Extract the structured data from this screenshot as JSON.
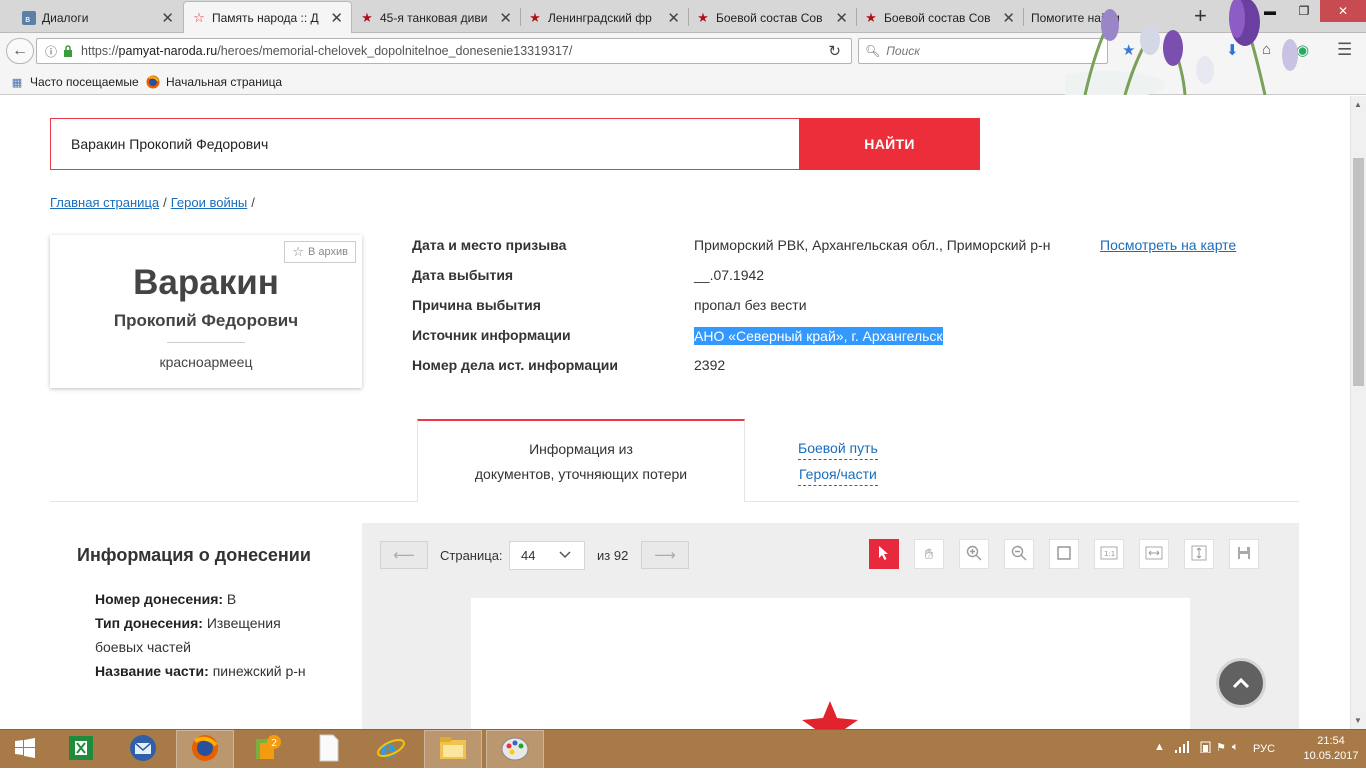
{
  "browser": {
    "tabs": [
      {
        "title": "Диалоги",
        "icon": "vk-icon"
      },
      {
        "title": "Память народа :: Д",
        "icon": "star-outline-icon",
        "active": true
      },
      {
        "title": "45-я танковая диви",
        "icon": "red-star-icon"
      },
      {
        "title": "Ленинградский фр",
        "icon": "red-star-icon"
      },
      {
        "title": "Боевой состав Сов",
        "icon": "red-star-icon"
      },
      {
        "title": "Боевой состав Сов",
        "icon": "red-star-icon"
      },
      {
        "title": "Помогите найти",
        "icon": ""
      }
    ],
    "url_prefix": "https://",
    "url_domain": "pamyat-naroda.ru",
    "url_path": "/heroes/memorial-chelovek_dopolnitelnoe_donesenie13319317/",
    "search_placeholder": "Поиск",
    "bookmarks": [
      "Часто посещаемые",
      "Начальная страница"
    ]
  },
  "search": {
    "value": "Варакин Прокопий Федорович",
    "button": "НАЙТИ"
  },
  "breadcrumb": {
    "home": "Главная страница",
    "heroes": "Герои войны",
    "sep": "/"
  },
  "person": {
    "archive_label": "В архив",
    "surname": "Варакин",
    "names": "Прокопий Федорович",
    "rank": "красноармеец"
  },
  "details": [
    {
      "label": "Дата и место призыва",
      "value": "Приморский РВК, Архангельская обл., Приморский р-н"
    },
    {
      "label": "Дата выбытия",
      "value": "__.07.1942"
    },
    {
      "label": "Причина выбытия",
      "value": "пропал без вести"
    },
    {
      "label": "Источник информации",
      "value": "АНО «Северный край», г. Архангельск"
    },
    {
      "label": "Номер дела ист. информации",
      "value": "2392"
    }
  ],
  "map_link": "Посмотреть на карте",
  "tabs": {
    "docs_line1": "Информация из",
    "docs_line2": "документов, уточняющих потери",
    "route_line1": "Боевой путь",
    "route_line2": "Героя/части"
  },
  "report": {
    "title": "Информация о донесении",
    "number_label": "Номер донесения:",
    "number_value": "В",
    "type_label": "Тип донесения:",
    "type_value": "Извещения боевых частей",
    "unit_label": "Название части:",
    "unit_value": "пинежский р-н"
  },
  "viewer": {
    "page_label": "Страница:",
    "page_value": "44",
    "of_label": "из 92"
  },
  "taskbar": {
    "lang": "РУС",
    "time": "21:54",
    "date": "10.05.2017"
  },
  "colors": {
    "accent": "#ec2d3a",
    "link": "#1a6dbb",
    "selection": "#3399ff",
    "taskbar": "#a87a48"
  }
}
